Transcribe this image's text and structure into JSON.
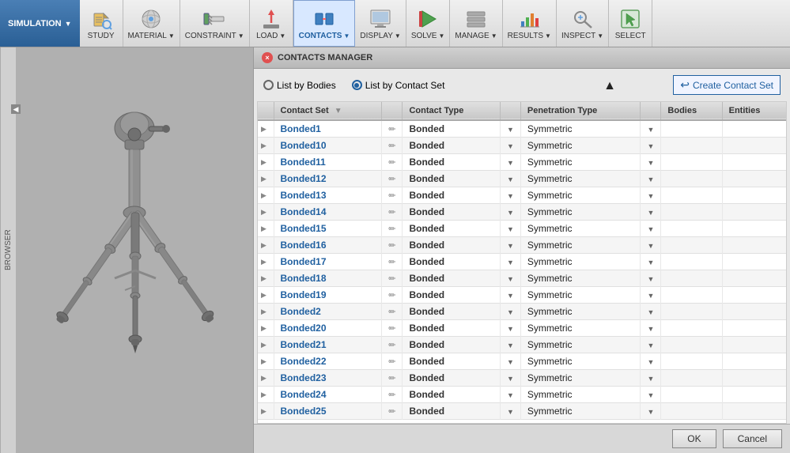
{
  "toolbar": {
    "simulation_label": "SIMULATION",
    "groups": [
      {
        "id": "study",
        "label": "STUDY",
        "icon": "🔬",
        "has_arrow": false
      },
      {
        "id": "material",
        "label": "MATERIAL",
        "icon": "🟥",
        "has_arrow": true
      },
      {
        "id": "constraint",
        "label": "CONSTRAINT",
        "icon": "📐",
        "has_arrow": true
      },
      {
        "id": "load",
        "label": "LOAD",
        "icon": "⬆",
        "has_arrow": true
      },
      {
        "id": "contacts",
        "label": "CONTACTS",
        "icon": "🔗",
        "has_arrow": true
      },
      {
        "id": "display",
        "label": "DISPLAY",
        "icon": "📊",
        "has_arrow": true
      },
      {
        "id": "solve",
        "label": "SOLVE",
        "icon": "▶",
        "has_arrow": true
      },
      {
        "id": "manage",
        "label": "MANAGE",
        "icon": "🗂",
        "has_arrow": true
      },
      {
        "id": "results",
        "label": "RESULTS",
        "icon": "📈",
        "has_arrow": true
      },
      {
        "id": "inspect",
        "label": "INSPECT",
        "icon": "🔍",
        "has_arrow": true
      },
      {
        "id": "select",
        "label": "SELECT",
        "icon": "↗",
        "has_arrow": false
      }
    ]
  },
  "browser_tab": "BROWSER",
  "panel": {
    "title": "CONTACTS MANAGER",
    "radio_bodies_label": "List by Bodies",
    "radio_contact_set_label": "List by Contact Set",
    "radio_selected": "contact_set",
    "create_button_label": "Create Contact Set",
    "table": {
      "headers": [
        "Contact Set",
        "",
        "Contact Type",
        "",
        "Penetration Type",
        "",
        "Bodies",
        "Entities"
      ],
      "col_contact_set": "Contact Set",
      "col_contact_type": "Contact Type",
      "col_penetration": "Penetration Type",
      "col_bodies": "Bodies",
      "col_entities": "Entities",
      "rows": [
        {
          "name": "Bonded1",
          "contact_type": "Bonded",
          "penetration": "Symmetric"
        },
        {
          "name": "Bonded10",
          "contact_type": "Bonded",
          "penetration": "Symmetric"
        },
        {
          "name": "Bonded11",
          "contact_type": "Bonded",
          "penetration": "Symmetric"
        },
        {
          "name": "Bonded12",
          "contact_type": "Bonded",
          "penetration": "Symmetric"
        },
        {
          "name": "Bonded13",
          "contact_type": "Bonded",
          "penetration": "Symmetric"
        },
        {
          "name": "Bonded14",
          "contact_type": "Bonded",
          "penetration": "Symmetric"
        },
        {
          "name": "Bonded15",
          "contact_type": "Bonded",
          "penetration": "Symmetric"
        },
        {
          "name": "Bonded16",
          "contact_type": "Bonded",
          "penetration": "Symmetric"
        },
        {
          "name": "Bonded17",
          "contact_type": "Bonded",
          "penetration": "Symmetric"
        },
        {
          "name": "Bonded18",
          "contact_type": "Bonded",
          "penetration": "Symmetric"
        },
        {
          "name": "Bonded19",
          "contact_type": "Bonded",
          "penetration": "Symmetric"
        },
        {
          "name": "Bonded2",
          "contact_type": "Bonded",
          "penetration": "Symmetric"
        },
        {
          "name": "Bonded20",
          "contact_type": "Bonded",
          "penetration": "Symmetric"
        },
        {
          "name": "Bonded21",
          "contact_type": "Bonded",
          "penetration": "Symmetric"
        },
        {
          "name": "Bonded22",
          "contact_type": "Bonded",
          "penetration": "Symmetric"
        },
        {
          "name": "Bonded23",
          "contact_type": "Bonded",
          "penetration": "Symmetric"
        },
        {
          "name": "Bonded24",
          "contact_type": "Bonded",
          "penetration": "Symmetric"
        },
        {
          "name": "Bonded25",
          "contact_type": "Bonded",
          "penetration": "Symmetric"
        }
      ]
    },
    "ok_label": "OK",
    "cancel_label": "Cancel"
  }
}
